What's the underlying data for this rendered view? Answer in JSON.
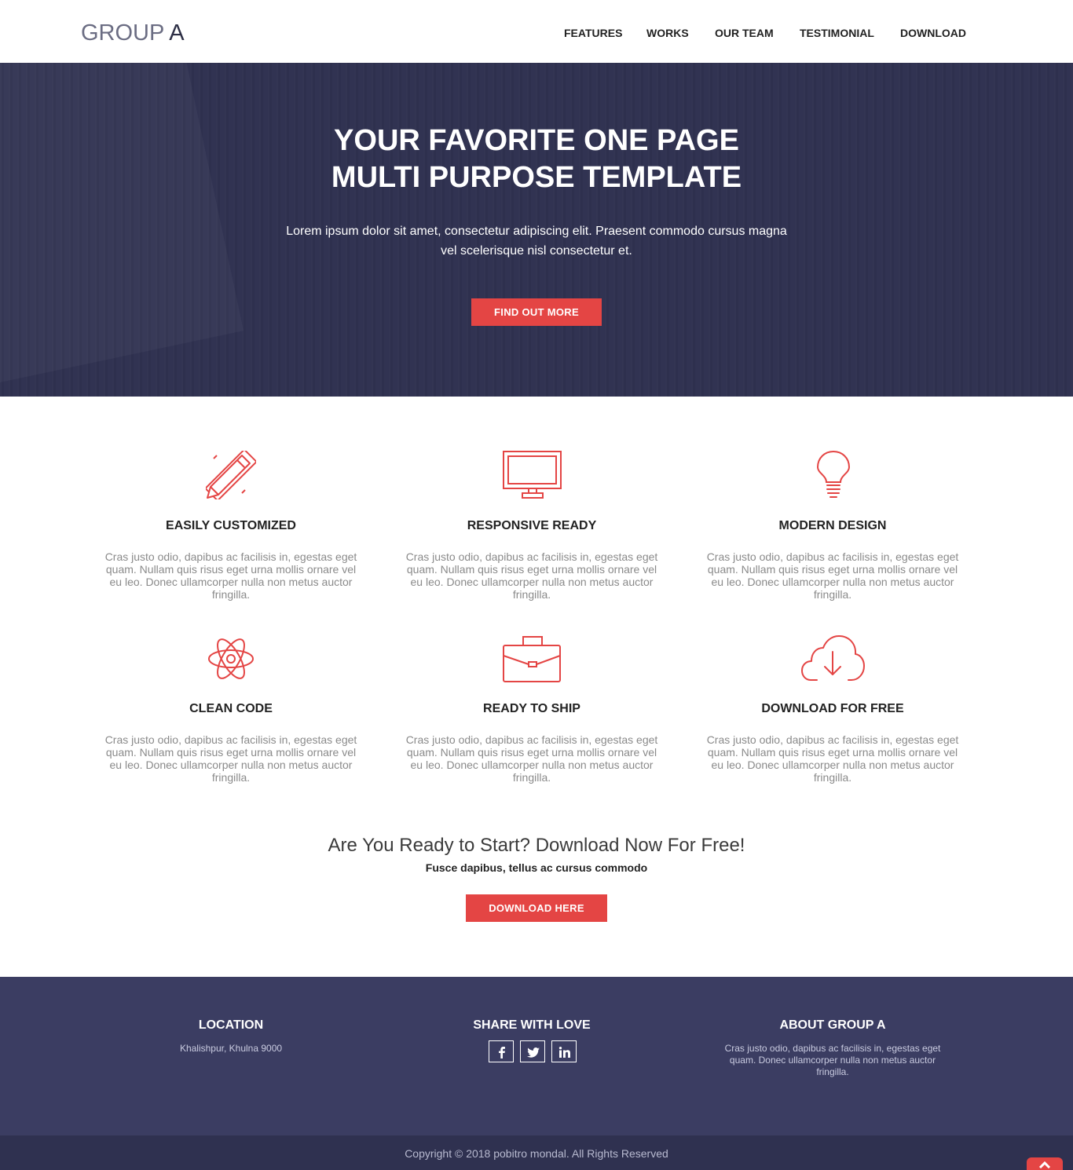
{
  "brand": {
    "part1": "GROUP ",
    "part2": "A"
  },
  "nav": {
    "items": [
      "FEATURES",
      "WORKS",
      "OUR TEAM",
      "TESTIMONIAL",
      "DOWNLOAD"
    ]
  },
  "hero": {
    "title_line1": "YOUR FAVORITE ONE PAGE",
    "title_line2": "MULTI PURPOSE TEMPLATE",
    "text_line1": "Lorem ipsum dolor sit amet, consectetur adipiscing elit. Praesent commodo cursus magna",
    "text_line2": "vel scelerisque nisl consectetur et.",
    "button": "FIND OUT MORE"
  },
  "features": [
    {
      "title": "EASILY CUSTOMIZED",
      "icon": "pencil-ruler-icon",
      "lines": [
        "Cras justo odio, dapibus ac facilisis in, egestas eget",
        "quam. Nullam quis risus eget urna mollis ornare vel",
        "eu leo. Donec ullamcorper nulla non metus auctor",
        "fringilla."
      ]
    },
    {
      "title": "RESPONSIVE READY",
      "icon": "monitor-icon",
      "lines": [
        "Cras justo odio, dapibus ac facilisis in, egestas eget",
        "quam. Nullam quis risus eget urna mollis ornare vel",
        "eu leo. Donec ullamcorper nulla non metus auctor",
        "fringilla."
      ]
    },
    {
      "title": "MODERN DESIGN",
      "icon": "lightbulb-icon",
      "lines": [
        "Cras justo odio, dapibus ac facilisis in, egestas eget",
        "quam. Nullam quis risus eget urna mollis ornare vel",
        "eu leo. Donec ullamcorper nulla non metus auctor",
        "fringilla."
      ]
    },
    {
      "title": "CLEAN CODE",
      "icon": "atom-icon",
      "lines": [
        "Cras justo odio, dapibus ac facilisis in, egestas eget",
        "quam. Nullam quis risus eget urna mollis ornare vel",
        "eu leo. Donec ullamcorper nulla non metus auctor",
        "fringilla."
      ]
    },
    {
      "title": "READY TO SHIP",
      "icon": "briefcase-icon",
      "lines": [
        "Cras justo odio, dapibus ac facilisis in, egestas eget",
        "quam. Nullam quis risus eget urna mollis ornare vel",
        "eu leo. Donec ullamcorper nulla non metus auctor",
        "fringilla."
      ]
    },
    {
      "title": "DOWNLOAD FOR FREE",
      "icon": "cloud-download-icon",
      "lines": [
        "Cras justo odio, dapibus ac facilisis in, egestas eget",
        "quam. Nullam quis risus eget urna mollis ornare vel",
        "eu leo. Donec ullamcorper nulla non metus auctor",
        "fringilla."
      ]
    }
  ],
  "cta": {
    "title": "Are You Ready to Start? Download Now For Free!",
    "subtitle": "Fusce dapibus, tellus ac cursus commodo",
    "button": "DOWNLOAD HERE"
  },
  "footer": {
    "location_title": "LOCATION",
    "location_text": "Khalishpur, Khulna 9000",
    "share_title": "SHARE WITH LOVE",
    "social": [
      "facebook-icon",
      "twitter-icon",
      "linkedin-icon"
    ],
    "about_title": "ABOUT GROUP A",
    "about_lines": [
      "Cras justo odio, dapibus ac facilisis in, egestas eget",
      "quam. Donec ullamcorper nulla non metus auctor",
      "fringilla."
    ],
    "copyright": "Copyright © 2018 pobitro mondal. All Rights Reserved"
  },
  "colors": {
    "accent": "#e44544",
    "hero_bg": "#2f3150",
    "footer_bg": "#3b3d62",
    "copy_bg": "#2f3150"
  }
}
